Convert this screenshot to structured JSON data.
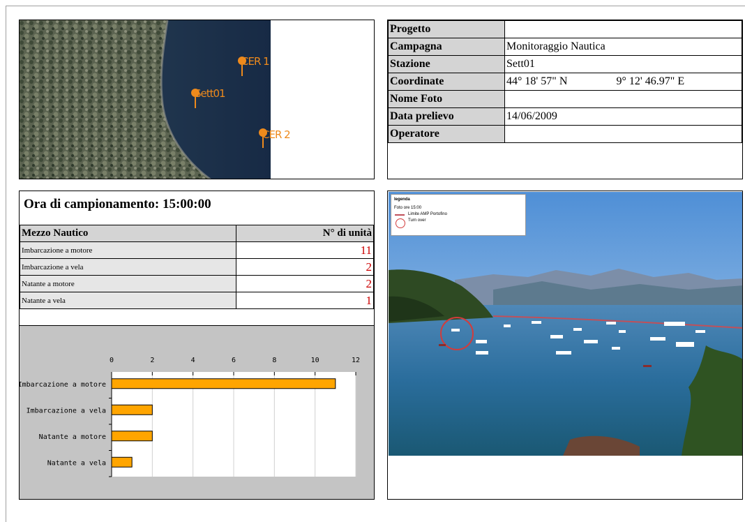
{
  "info": {
    "rows": [
      {
        "label": "Progetto",
        "value": "",
        "value2": ""
      },
      {
        "label": "Campagna",
        "value": "Monitoraggio Nautica",
        "value2": ""
      },
      {
        "label": "Stazione",
        "value": "Sett01",
        "value2": ""
      },
      {
        "label": "Coordinate",
        "value": "44° 18' 57\" N",
        "value2": "9° 12' 46.97\" E"
      },
      {
        "label": "Nome Foto",
        "value": "",
        "value2": ""
      },
      {
        "label": "Data prelievo",
        "value": "14/06/2009",
        "value2": ""
      },
      {
        "label": "Operatore",
        "value": "",
        "value2": ""
      }
    ]
  },
  "map": {
    "markers": [
      "CER 1",
      "Sett01",
      "CER 2"
    ],
    "colors": {
      "sea": "#1a2d4a",
      "land": "#5a6150",
      "marker": "#ee8a1c"
    }
  },
  "sampling": {
    "title": "Ora di campionamento: 15:00:00",
    "col1": "Mezzo Nautico",
    "col2": "N° di unità",
    "rows": [
      {
        "name": "Imbarcazione a motore",
        "count": "11"
      },
      {
        "name": "Imbarcazione a vela",
        "count": "2"
      },
      {
        "name": "Natante a motore",
        "count": "2"
      },
      {
        "name": "Natante a vela",
        "count": "1"
      }
    ]
  },
  "photo": {
    "legend_title": "legenda",
    "legend_sub": "Foto ore 15:00",
    "legend_items": [
      "Limite AMP Portofino",
      "Turn over"
    ]
  },
  "chart_data": {
    "type": "bar",
    "orientation": "horizontal",
    "categories": [
      "Imbarcazione a motore",
      "Imbarcazione a vela",
      "Natante a motore",
      "Natante a vela"
    ],
    "values": [
      11,
      2,
      2,
      1
    ],
    "xlim": [
      0,
      12
    ],
    "xticks": [
      "0",
      "2",
      "4",
      "6",
      "8",
      "10",
      "12"
    ],
    "title": "",
    "xlabel": "",
    "ylabel": "",
    "bar_color": "#ffa500",
    "grid": true
  }
}
